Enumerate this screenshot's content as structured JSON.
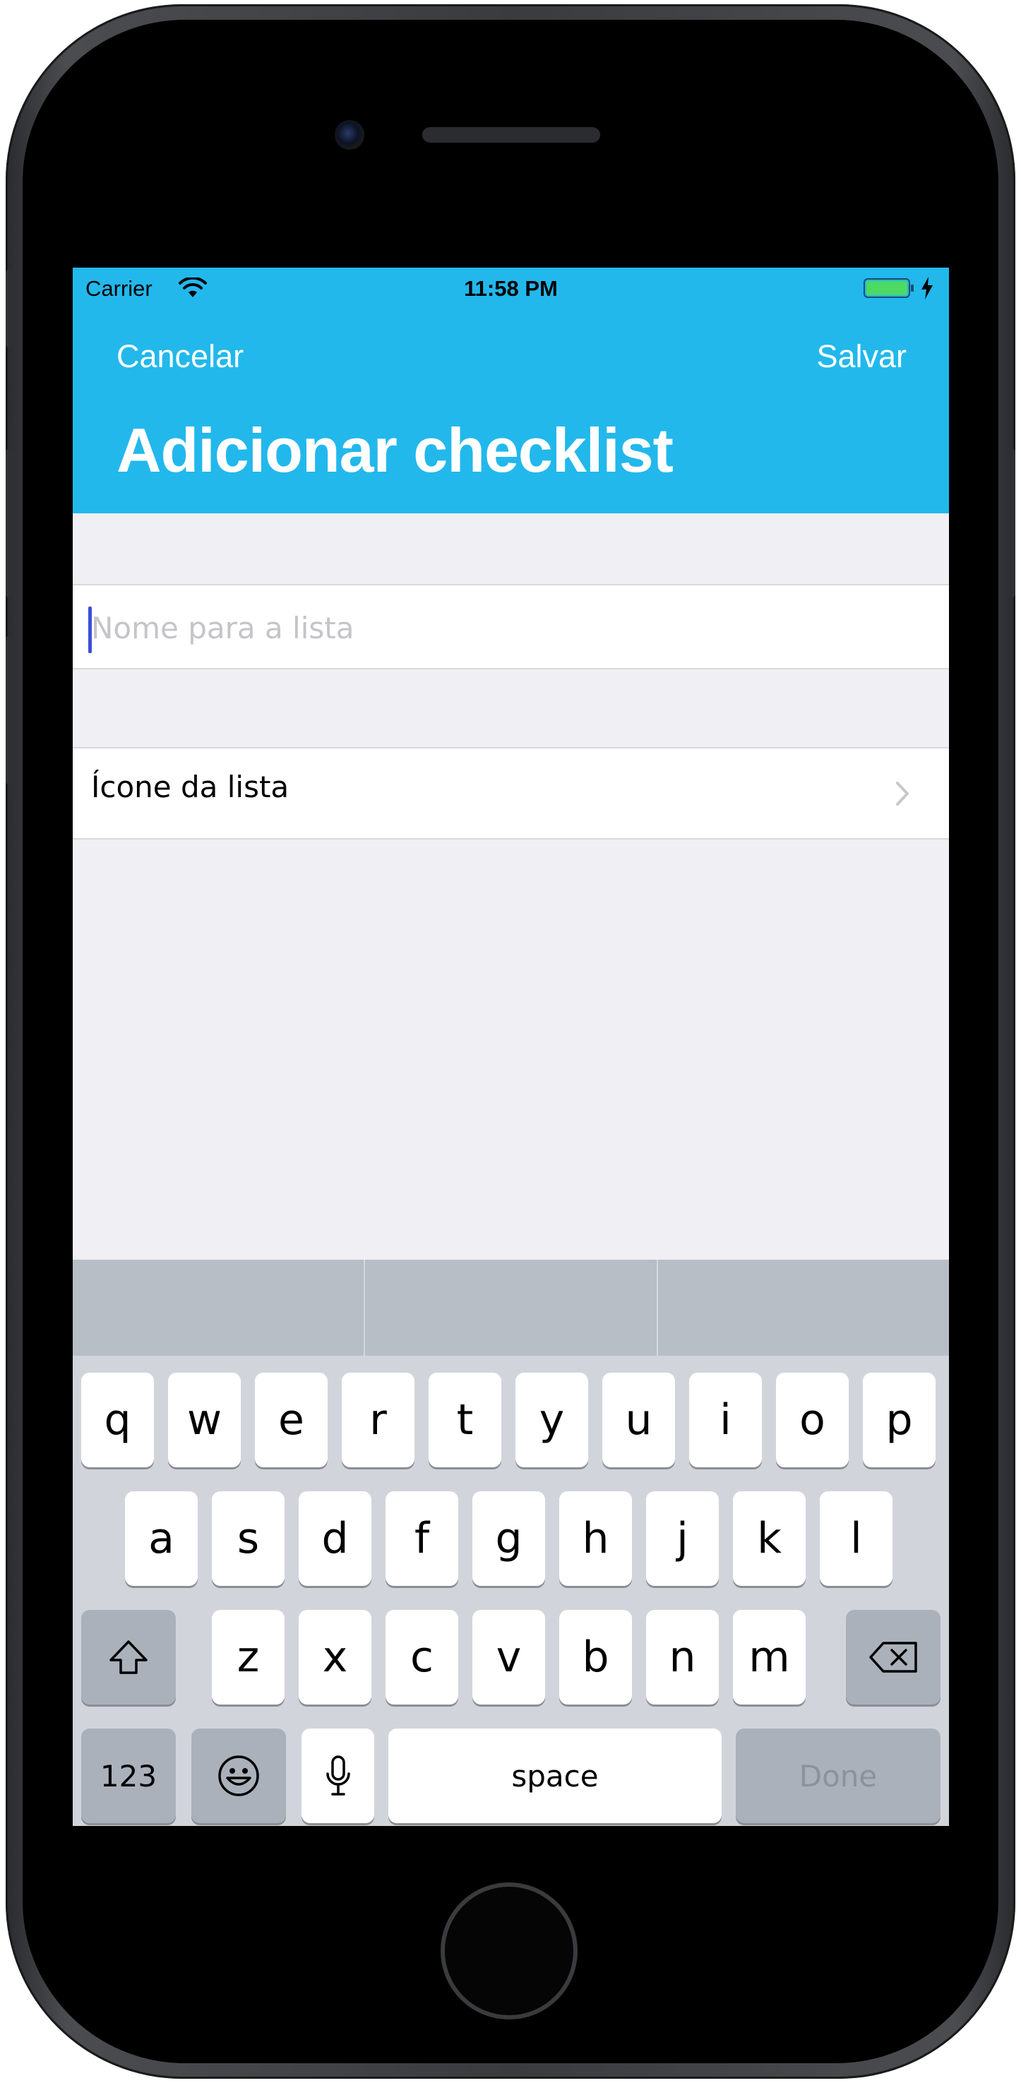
{
  "status_bar": {
    "carrier": "Carrier",
    "time": "11:58 PM"
  },
  "nav": {
    "cancel_label": "Cancelar",
    "save_label": "Salvar",
    "title": "Adicionar checklist"
  },
  "form": {
    "name_placeholder": "Nome para a lista",
    "name_value": "",
    "icon_row_label": "Ícone da lista"
  },
  "colors": {
    "header": "#22b8ec",
    "background": "#efeff4",
    "cursor": "#3b4fd8",
    "battery": "#4cd964"
  },
  "keyboard": {
    "row1": [
      "q",
      "w",
      "e",
      "r",
      "t",
      "y",
      "u",
      "i",
      "o",
      "p"
    ],
    "row2": [
      "a",
      "s",
      "d",
      "f",
      "g",
      "h",
      "j",
      "k",
      "l"
    ],
    "row3": [
      "z",
      "x",
      "c",
      "v",
      "b",
      "n",
      "m"
    ],
    "numbers_label": "123",
    "space_label": "space",
    "done_label": "Done"
  }
}
